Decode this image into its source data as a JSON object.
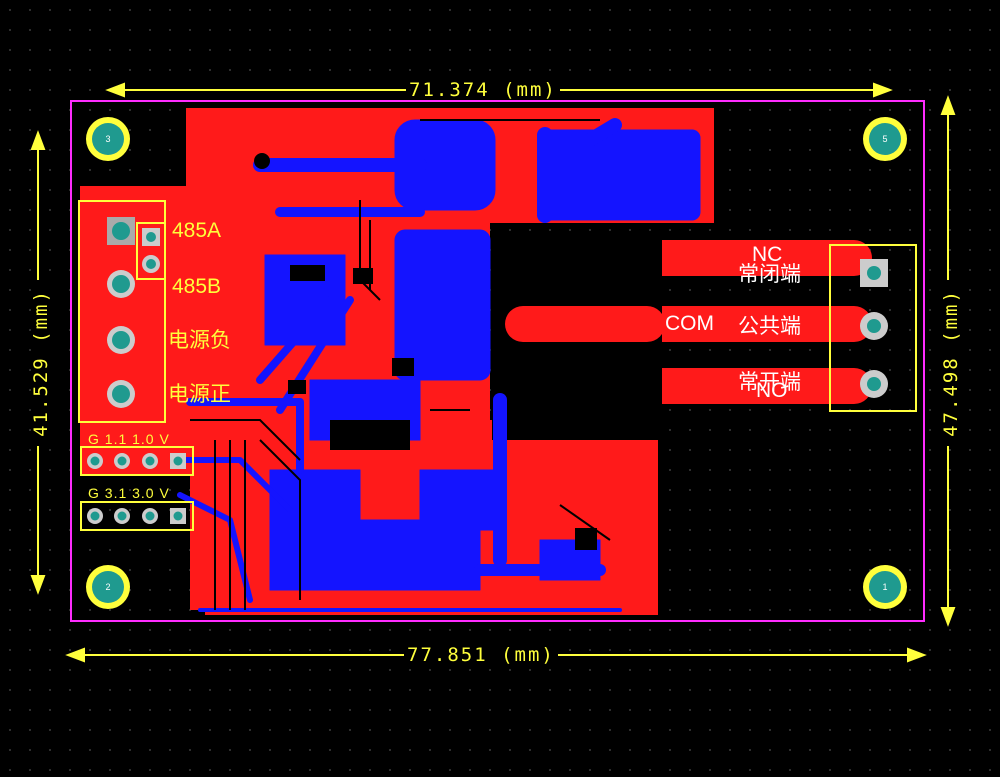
{
  "dimensions": {
    "top": "71.374 (mm)",
    "bottom": "77.851 (mm)",
    "left": "41.529 (mm)",
    "right": "47.498 (mm)"
  },
  "labels": {
    "rs485_a": "485A",
    "rs485_b": "485B",
    "power_negative": "电源负",
    "power_positive": "电源正",
    "jumper_1": "G 1.1 1.0 V",
    "jumper_2": "G 3.1 3.0 V",
    "nc": "NC",
    "normally_closed": "常闭端",
    "com": "COM",
    "common": "公共端",
    "no": "NO",
    "normally_open": "常开端"
  },
  "mounting_holes": [
    "3",
    "5",
    "2",
    "1"
  ],
  "colors": {
    "top_copper": "#ff1a1a",
    "bottom_copper": "#1414ff",
    "silkscreen": "#ffff3c",
    "board_outline": "#ff2cff",
    "pad": "#1f9a8f",
    "background": "#000000"
  }
}
